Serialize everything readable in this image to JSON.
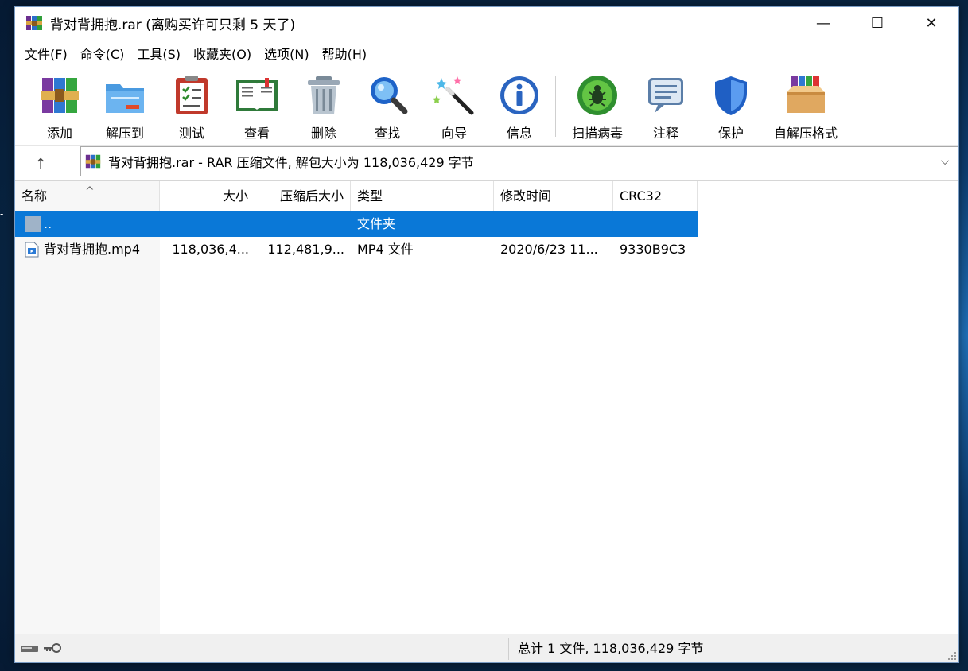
{
  "window": {
    "title": "背对背拥抱.rar (离购买许可只剩 5 天了)",
    "controls": {
      "minimize": "—",
      "maximize": "☐",
      "close": "✕"
    }
  },
  "menu": [
    "文件(F)",
    "命令(C)",
    "工具(S)",
    "收藏夹(O)",
    "选项(N)",
    "帮助(H)"
  ],
  "toolbar": [
    {
      "label": "添加",
      "icon": "add-archive-icon"
    },
    {
      "label": "解压到",
      "icon": "extract-to-icon"
    },
    {
      "label": "测试",
      "icon": "test-icon"
    },
    {
      "label": "查看",
      "icon": "view-book-icon"
    },
    {
      "label": "删除",
      "icon": "trash-icon"
    },
    {
      "label": "查找",
      "icon": "search-icon"
    },
    {
      "label": "向导",
      "icon": "wizard-wand-icon"
    },
    {
      "label": "信息",
      "icon": "info-icon"
    },
    {
      "label": "扫描病毒",
      "icon": "virus-scan-icon"
    },
    {
      "label": "注释",
      "icon": "comment-icon"
    },
    {
      "label": "保护",
      "icon": "shield-icon"
    },
    {
      "label": "自解压格式",
      "icon": "sfx-box-icon"
    }
  ],
  "address": {
    "up": "↑",
    "text": "背对背拥抱.rar - RAR 压缩文件, 解包大小为 118,036,429 字节",
    "dropdown": "⌵"
  },
  "columns": [
    "名称",
    "大小",
    "压缩后大小",
    "类型",
    "修改时间",
    "CRC32"
  ],
  "sort_caret": "^",
  "rows": [
    {
      "name": "..",
      "size": "",
      "packed": "",
      "type": "文件夹",
      "modified": "",
      "crc": "",
      "selected": true
    },
    {
      "name": "背对背拥抱.mp4",
      "size": "118,036,4...",
      "packed": "112,481,9...",
      "type": "MP4 文件",
      "modified": "2020/6/23 11...",
      "crc": "9330B9C3",
      "selected": false
    }
  ],
  "status": {
    "text": "总计 1 文件, 118,036,429 字节"
  },
  "desktop_glyph": "-",
  "colors": {
    "selection": "#0a78d7",
    "accent": "#1e6fd0"
  }
}
